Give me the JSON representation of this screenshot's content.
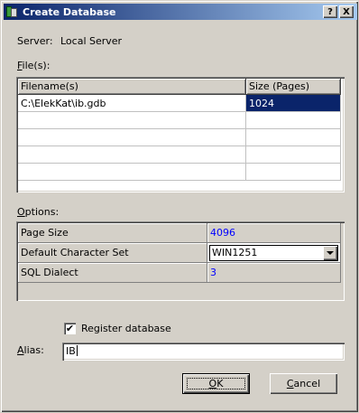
{
  "window": {
    "title": "Create Database",
    "help_glyph": "?",
    "close_glyph": "X"
  },
  "server": {
    "label": "Server:",
    "value": "Local Server"
  },
  "files": {
    "label_prefix": "",
    "label_hotkey": "F",
    "label_rest": "ile(s):",
    "columns": [
      "Filename(s)",
      "Size (Pages)"
    ],
    "rows": [
      {
        "filename": "C:\\ElekKat\\ib.gdb",
        "size": "1024"
      },
      {
        "filename": "",
        "size": ""
      },
      {
        "filename": "",
        "size": ""
      },
      {
        "filename": "",
        "size": ""
      },
      {
        "filename": "",
        "size": ""
      }
    ]
  },
  "options": {
    "label_hotkey": "O",
    "label_rest": "ptions:",
    "rows": [
      {
        "name": "Page Size",
        "value": "4096"
      },
      {
        "name": "Default Character Set",
        "value": "WIN1251"
      },
      {
        "name": "SQL Dialect",
        "value": "3"
      }
    ]
  },
  "register": {
    "label": "Register database",
    "checked": true,
    "check_glyph": "✔"
  },
  "alias": {
    "label_hotkey": "A",
    "label_rest": "lias:",
    "value": "IB"
  },
  "buttons": {
    "ok_hotkey": "O",
    "ok_rest": "K",
    "cancel_hotkey": "C",
    "cancel_rest": "ancel"
  }
}
